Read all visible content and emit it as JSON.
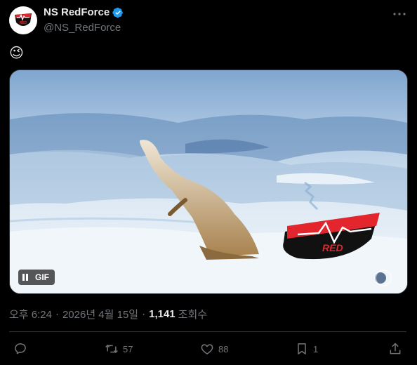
{
  "author": {
    "display_name": "NS RedForce",
    "handle": "@NS_RedForce",
    "verified": true,
    "avatar_icon": "redforce-logo-icon"
  },
  "tweet": {
    "text": "😉"
  },
  "media": {
    "type": "gif",
    "badge": "GIF",
    "watermark_text": "RED",
    "control_icon": "pause-icon"
  },
  "meta": {
    "time": "오후 6:24",
    "separator": "·",
    "date": "2026년 4월 15일",
    "views_count": "1,141",
    "views_label": "조회수"
  },
  "actions": {
    "reply_count": "",
    "retweet_count": "57",
    "like_count": "88",
    "bookmark_count": "1"
  },
  "colors": {
    "background": "#000000",
    "text_primary": "#e7e9ea",
    "text_secondary": "#71767b",
    "verified_blue": "#1d9bf0",
    "brand_red": "#e3262d",
    "divider": "#2f3336"
  }
}
